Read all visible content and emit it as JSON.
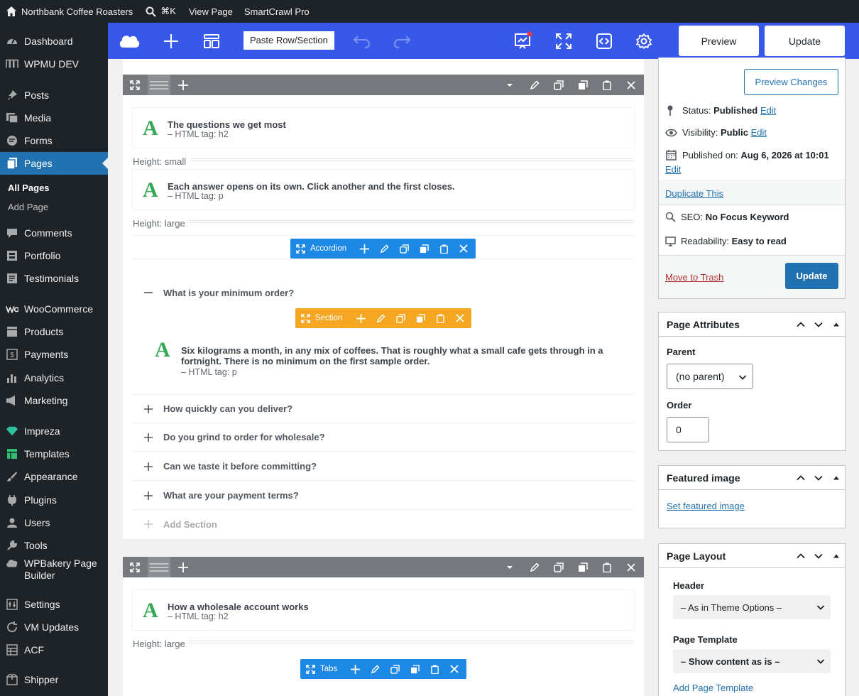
{
  "adminbar": {
    "site_name": "Northbank Coffee Roasters",
    "shortcut": "⌘K",
    "view_page": "View Page",
    "plugin": "SmartCrawl Pro"
  },
  "sidebar": {
    "items": [
      {
        "label": "Dashboard",
        "icon": "dashboard-icon"
      },
      {
        "label": "WPMU DEV",
        "icon": "wpmudev-icon"
      },
      {
        "label": "Posts",
        "icon": "pin-icon"
      },
      {
        "label": "Media",
        "icon": "media-icon"
      },
      {
        "label": "Forms",
        "icon": "forms-icon"
      },
      {
        "label": "Pages",
        "icon": "pages-icon"
      },
      {
        "label": "Comments",
        "icon": "comments-icon"
      },
      {
        "label": "Portfolio",
        "icon": "portfolio-icon"
      },
      {
        "label": "Testimonials",
        "icon": "testimonials-icon"
      },
      {
        "label": "WooCommerce",
        "icon": "woo-icon"
      },
      {
        "label": "Products",
        "icon": "products-icon"
      },
      {
        "label": "Payments",
        "icon": "payments-icon"
      },
      {
        "label": "Analytics",
        "icon": "analytics-icon"
      },
      {
        "label": "Marketing",
        "icon": "marketing-icon"
      },
      {
        "label": "Impreza",
        "icon": "impreza-icon"
      },
      {
        "label": "Templates",
        "icon": "templates-icon"
      },
      {
        "label": "Appearance",
        "icon": "appearance-icon"
      },
      {
        "label": "Plugins",
        "icon": "plugins-icon"
      },
      {
        "label": "Users",
        "icon": "users-icon"
      },
      {
        "label": "Tools",
        "icon": "tools-icon"
      },
      {
        "label": "WPBakery Page Builder",
        "icon": "wpbakery-icon"
      },
      {
        "label": "Settings",
        "icon": "settings-icon"
      },
      {
        "label": "VM Updates",
        "icon": "updates-icon"
      },
      {
        "label": "ACF",
        "icon": "acf-icon"
      },
      {
        "label": "Shipper",
        "icon": "shipper-icon"
      }
    ],
    "submenu": {
      "all_pages": "All Pages",
      "add_page": "Add Page"
    }
  },
  "toolbar": {
    "paste": "Paste Row/Section",
    "preview": "Preview",
    "update": "Update"
  },
  "editor": {
    "el1": {
      "title": "The questions we get most",
      "tag": "– HTML tag: h2"
    },
    "height1": "Height: small",
    "el2": {
      "title": "Each answer opens on its own. Click another and the first closes.",
      "tag": "– HTML tag: p"
    },
    "height2": "Height: large",
    "accordion_label": "Accordion",
    "open_question": "What is your minimum order?",
    "section_label": "Section",
    "answer_line1": "Six kilograms a month, in any mix of coffees. That is roughly what a small cafe gets through in a",
    "answer_line2": "fortnight. There is no minimum on the first sample order.",
    "answer_tag": "– HTML tag: p",
    "questions": [
      "How quickly can you deliver?",
      "Do you grind to order for wholesale?",
      "Can we taste it before committing?",
      "What are your payment terms?"
    ],
    "add_section": "Add Section",
    "el3": {
      "title": "How a wholesale account works",
      "tag": "– HTML tag: h2"
    },
    "height3": "Height: large",
    "tabs_label": "Tabs"
  },
  "publish": {
    "preview_changes": "Preview Changes",
    "status_label": "Status:",
    "status_value": "Published",
    "visibility_label": "Visibility:",
    "visibility_value": "Public",
    "published_label": "Published on:",
    "published_value": "Aug 6, 2026 at 10:01",
    "edit": "Edit",
    "duplicate": "Duplicate This",
    "seo_label": "SEO:",
    "seo_value": "No Focus Keyword",
    "readability_label": "Readability:",
    "readability_value": "Easy to read",
    "trash": "Move to Trash",
    "update": "Update"
  },
  "attributes": {
    "title": "Page Attributes",
    "parent_label": "Parent",
    "parent_value": "(no parent)",
    "order_label": "Order",
    "order_value": "0"
  },
  "featured": {
    "title": "Featured image",
    "link": "Set featured image"
  },
  "layout": {
    "title": "Page Layout",
    "header_label": "Header",
    "header_value": "– As in Theme Options –",
    "template_label": "Page Template",
    "template_value": "– Show content as is –",
    "add_template": "Add Page Template"
  },
  "colors": {
    "wp_dark": "#1d2327",
    "wp_blue": "#2271b1",
    "builder_blue": "#3858e9",
    "accordion_blue": "#1e88e5",
    "section_orange": "#f5a623",
    "row_gray": "#75787d",
    "text_green": "#34a853"
  }
}
